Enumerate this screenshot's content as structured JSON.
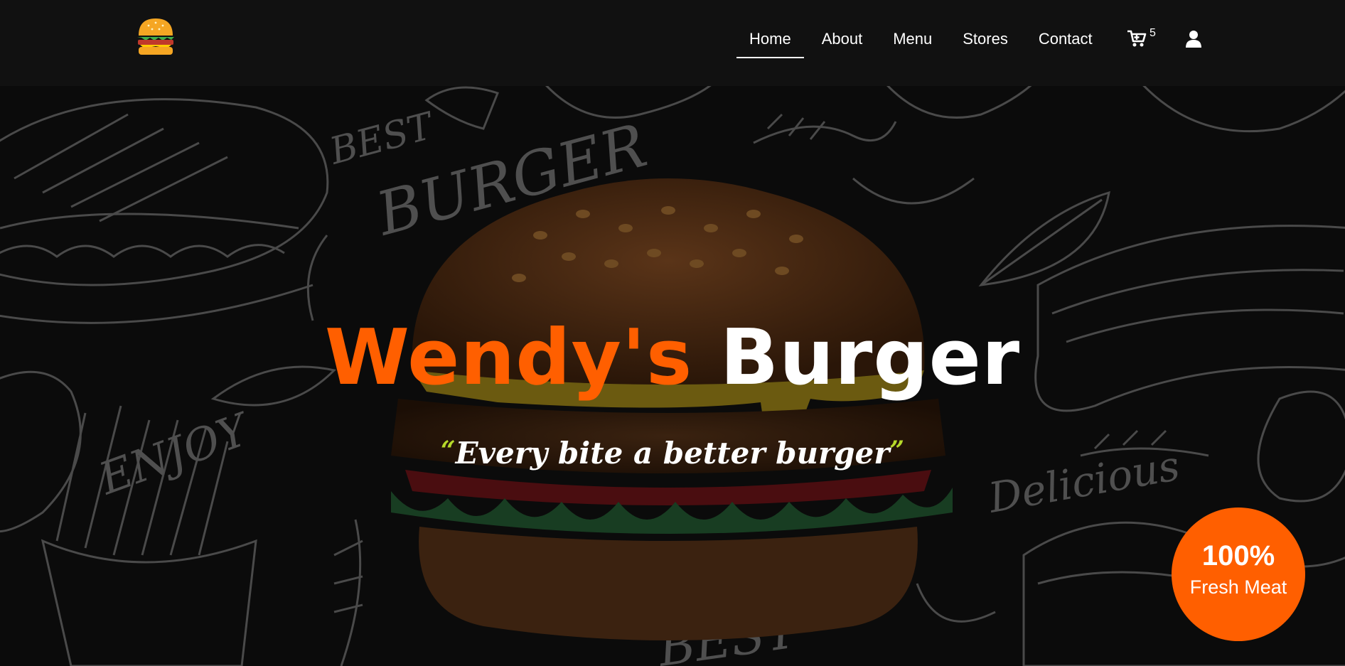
{
  "nav": {
    "items": [
      {
        "label": "Home",
        "active": true
      },
      {
        "label": "About"
      },
      {
        "label": "Menu"
      },
      {
        "label": "Stores"
      },
      {
        "label": "Contact"
      }
    ],
    "cart_icon": "cart-icon",
    "cart_count": "5",
    "user_icon": "user-icon",
    "logo_icon": "burger-logo-icon"
  },
  "hero": {
    "title_part1": "Wendy's",
    "title_part2": "Burger",
    "tagline": "Every bite a better burger",
    "quote_open": "“",
    "quote_close": "”",
    "badge_percent": "100%",
    "badge_label": "Fresh Meat",
    "doodle_words": [
      "BEST",
      "BURGER",
      "ENJOY",
      "Delicious",
      "BEST"
    ]
  },
  "colors": {
    "accent": "#ff5f00",
    "nav_bg": "#111111",
    "hero_bg": "#0b0b0b",
    "quote": "#b6d92a"
  }
}
